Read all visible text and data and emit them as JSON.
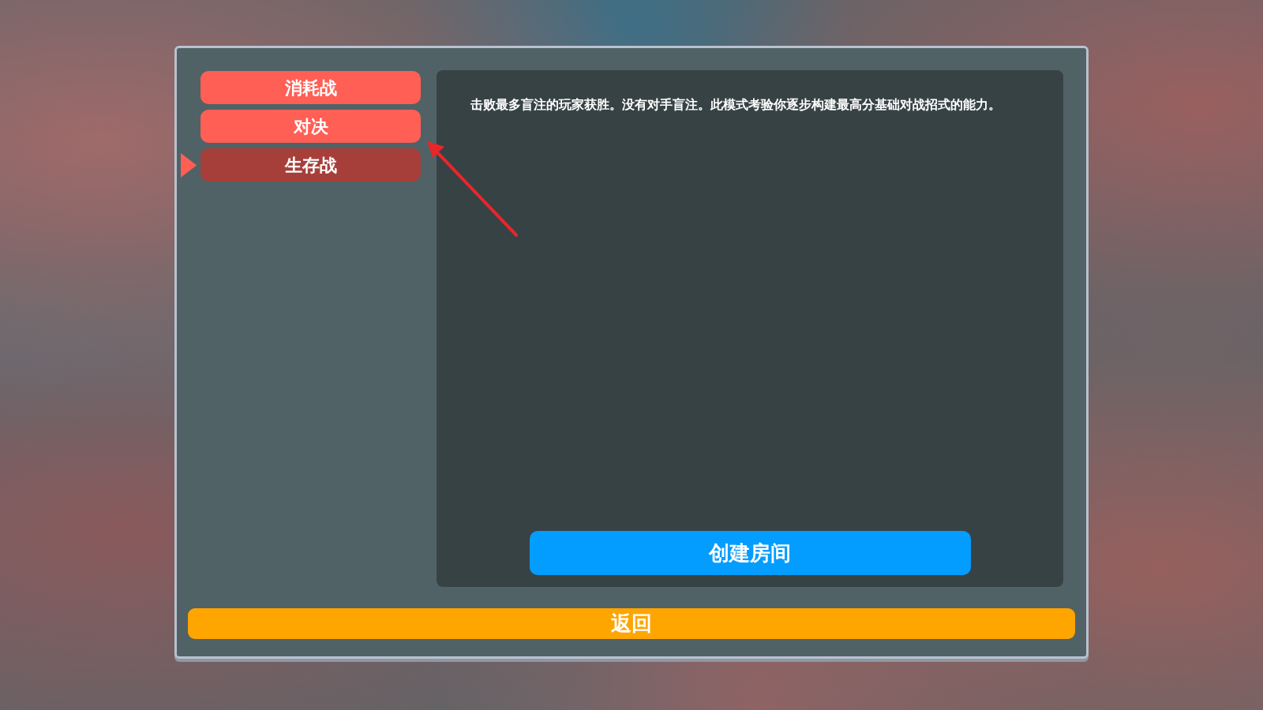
{
  "modes": [
    {
      "label": "消耗战",
      "selected": false
    },
    {
      "label": "对决",
      "selected": false
    },
    {
      "label": "生存战",
      "selected": true
    }
  ],
  "description": "击败最多盲注的玩家获胜。没有对手盲注。此模式考验你逐步构建最高分基础对战招式的能力。",
  "create_room_button": "创建房间",
  "back_button": "返回"
}
